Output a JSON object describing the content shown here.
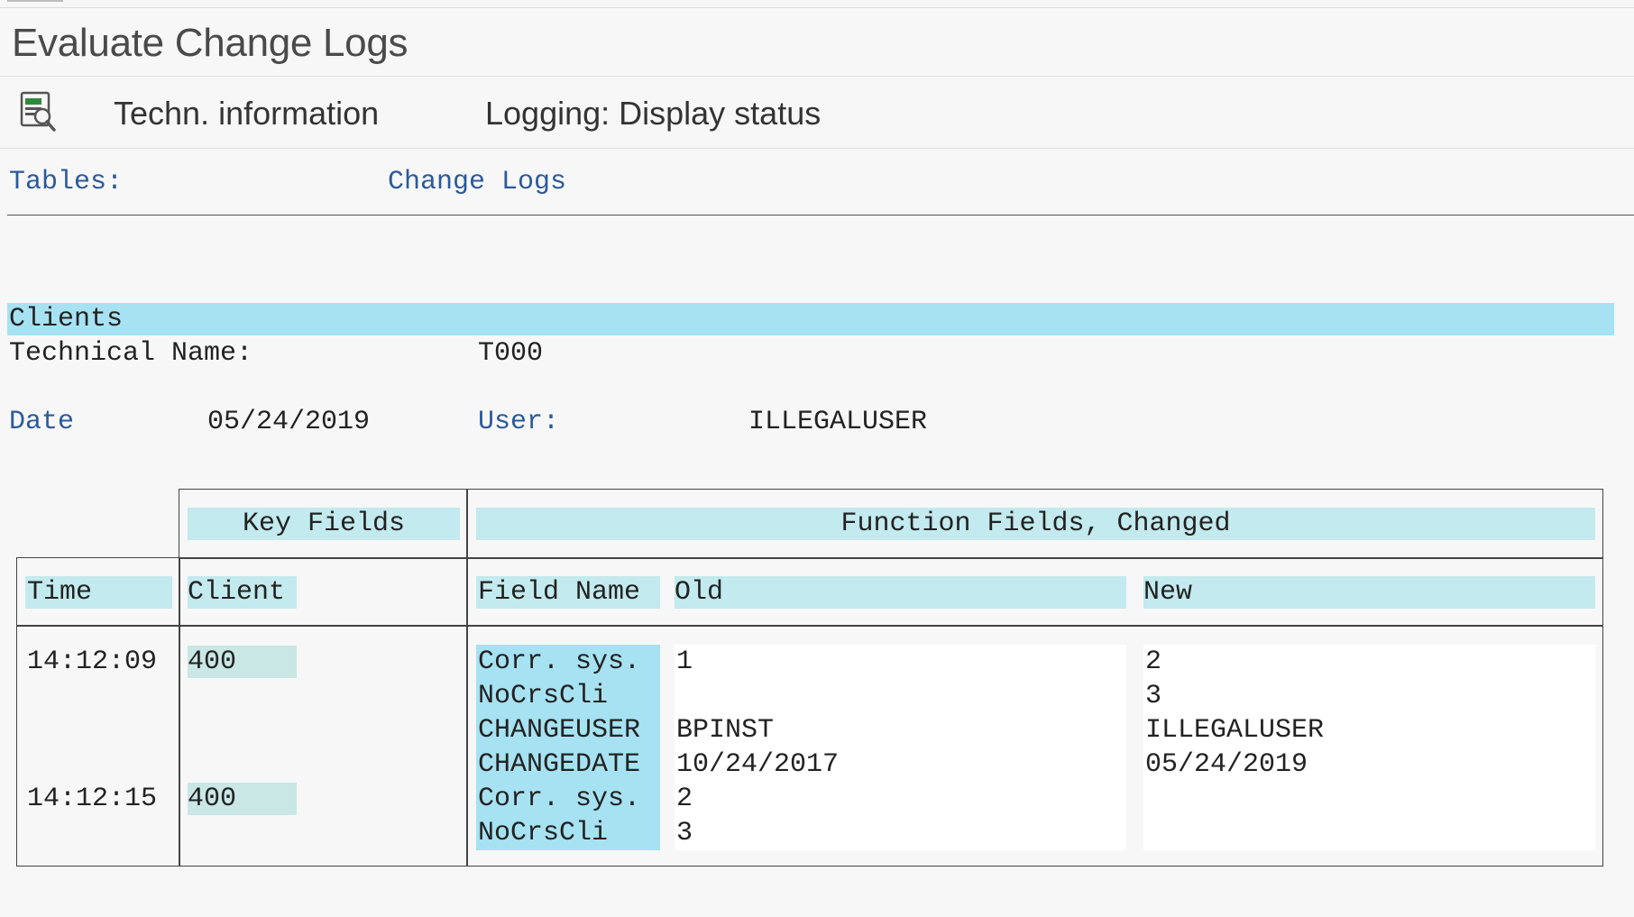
{
  "window": {
    "title": "Evaluate Change Logs"
  },
  "toolbar": {
    "icon": "display-log-icon",
    "techn_info": "Techn. information",
    "logging_status": "Logging: Display status"
  },
  "nav": {
    "tables": "Tables:",
    "change_logs": "Change Logs"
  },
  "section": {
    "title": "Clients",
    "technical_name_label": "Technical Name:",
    "technical_name_value": "T000",
    "date_label": "Date",
    "date_value": "05/24/2019",
    "user_label": "User:",
    "user_value": "ILLEGALUSER"
  },
  "table": {
    "group_headers": {
      "key_fields": "Key Fields",
      "function_fields": "Function Fields, Changed"
    },
    "columns": {
      "time": "Time",
      "client": "Client",
      "field_name": "Field Name",
      "old": "Old",
      "new": "New"
    },
    "groups": [
      {
        "time": "14:12:09",
        "client": "400"
      },
      {
        "time": "14:12:15",
        "client": "400"
      }
    ],
    "rows": [
      {
        "field": "Corr. sys.",
        "old": "1",
        "new": "2"
      },
      {
        "field": "NoCrsCli",
        "old": "",
        "new": "3"
      },
      {
        "field": "CHANGEUSER",
        "old": "BPINST",
        "new": "ILLEGALUSER"
      },
      {
        "field": "CHANGEDATE",
        "old": "10/24/2017",
        "new": "05/24/2019"
      },
      {
        "field": "Corr. sys.",
        "old": "2",
        "new": ""
      },
      {
        "field": "NoCrsCli",
        "old": "3",
        "new": ""
      }
    ]
  },
  "colors": {
    "band": "#a6e2f2",
    "header": "#c3eaee",
    "link": "#2b5a9a"
  }
}
